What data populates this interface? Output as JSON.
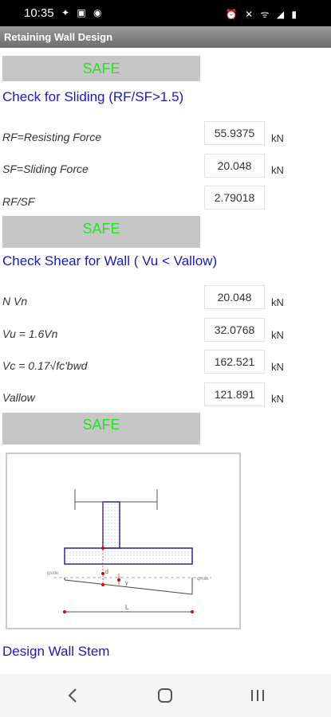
{
  "status_bar": {
    "time": "10:35",
    "left_icons": "✦ ▣ ◉",
    "right_icons": "⏰ ✕ ᯤ ◢ ▮"
  },
  "app_title": "Retaining Wall Design",
  "sliding": {
    "status": "SAFE",
    "heading": "Check for Sliding (RF/SF>1.5)",
    "rows": [
      {
        "label": "RF=Resisting Force",
        "value": "55.9375",
        "unit": "kN"
      },
      {
        "label": "SF=Sliding Force",
        "value": "20.048",
        "unit": "kN"
      },
      {
        "label": "RF/SF",
        "value": "2.79018",
        "unit": ""
      }
    ]
  },
  "shear": {
    "status": "SAFE",
    "heading": "Check Shear for Wall ( Vu < Vallow)",
    "rows": [
      {
        "label": "N Vn",
        "value": "20.048",
        "unit": "kN"
      },
      {
        "label": "Vu = 1.6Vn",
        "value": "32.0768",
        "unit": "kN"
      },
      {
        "label": "Vc = 0.17√fc'bwd",
        "value": "162.521",
        "unit": "kN"
      },
      {
        "label": "Vallow",
        "value": "121.891",
        "unit": "kN"
      }
    ]
  },
  "third_status": "SAFE",
  "diagram": {
    "label_left": "qside",
    "label_right": "qmax",
    "label_d": "d",
    "label_y": "y",
    "label_L": "L"
  },
  "design_link": "Design  Wall Stem",
  "colors": {
    "safe_text": "#28e028",
    "safe_bg": "#c6c6c6",
    "heading": "#1a1ab4"
  }
}
